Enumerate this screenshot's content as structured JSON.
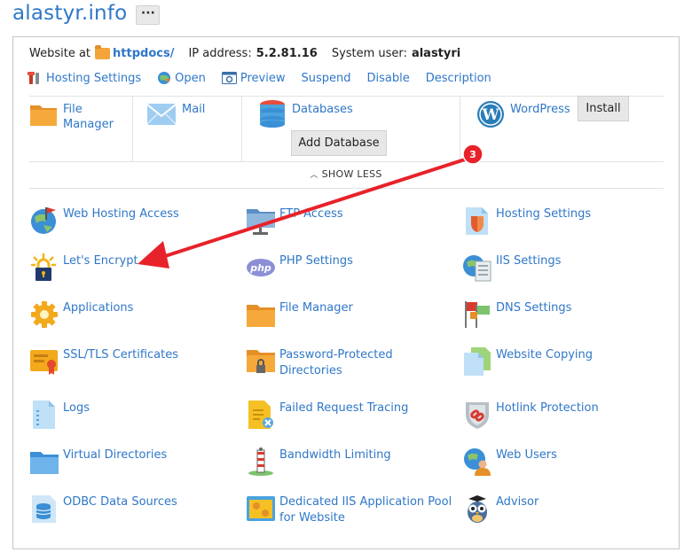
{
  "header": {
    "site_title": "alastyr.info",
    "more_label": "···"
  },
  "info": {
    "website_label": "Website at",
    "docroot": "httpdocs/",
    "ip_label": "IP address:",
    "ip_value": "5.2.81.16",
    "user_label": "System user:",
    "user_value": "alastyri"
  },
  "actions": [
    {
      "label": "Hosting Settings",
      "icon": "tools-icon"
    },
    {
      "label": "Open",
      "icon": "open-globe-icon"
    },
    {
      "label": "Preview",
      "icon": "preview-icon"
    },
    {
      "label": "Suspend"
    },
    {
      "label": "Disable"
    },
    {
      "label": "Description"
    }
  ],
  "quick": {
    "file_manager": "File Manager",
    "mail": "Mail",
    "databases": "Databases",
    "add_database": "Add Database",
    "wordpress": "WordPress",
    "install": "Install"
  },
  "show_less": "SHOW LESS",
  "callout": {
    "number": "3",
    "color": "#e8222a"
  },
  "tools": {
    "web_hosting_access": "Web Hosting Access",
    "ftp_access": "FTP Access",
    "hosting_settings": "Hosting Settings",
    "lets_encrypt": "Let's Encrypt",
    "php_settings": "PHP Settings",
    "iis_settings": "IIS Settings",
    "applications": "Applications",
    "file_manager": "File Manager",
    "dns_settings": "DNS Settings",
    "ssl_tls": "SSL/TLS Certificates",
    "password_protected": "Password-Protected Directories",
    "website_copying": "Website Copying",
    "logs": "Logs",
    "failed_request_tracing": "Failed Request Tracing",
    "hotlink_protection": "Hotlink Protection",
    "virtual_directories": "Virtual Directories",
    "bandwidth_limiting": "Bandwidth Limiting",
    "web_users": "Web Users",
    "odbc": "ODBC Data Sources",
    "dedicated_pool": "Dedicated IIS Application Pool for Website",
    "advisor": "Advisor"
  },
  "colors": {
    "link": "#2f77c8",
    "folder": "#f3a53a",
    "callout": "#e8222a"
  }
}
